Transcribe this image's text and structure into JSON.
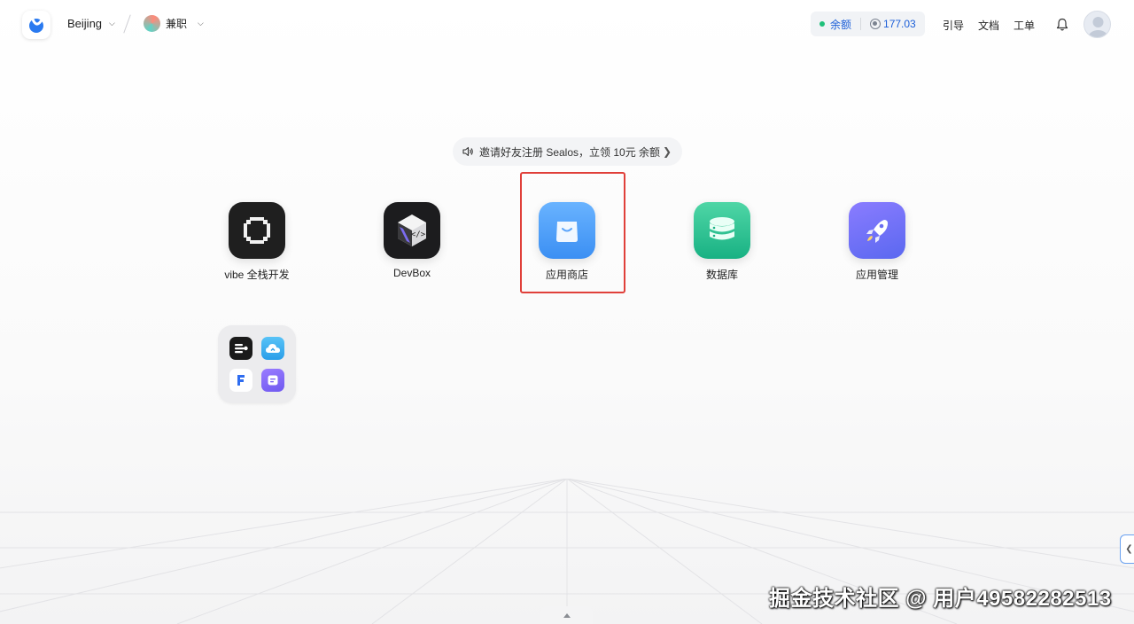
{
  "header": {
    "region": "Beijing",
    "workspace": "兼职",
    "balance_label": "余额",
    "balance_amount": "177.03",
    "nav": [
      "引导",
      "文档",
      "工单"
    ]
  },
  "promo": {
    "text": "邀请好友注册 Sealos，立领 10元 余额"
  },
  "apps": [
    {
      "label": "vibe 全栈开发",
      "icon": "vibe-icon"
    },
    {
      "label": "DevBox",
      "icon": "devbox-icon"
    },
    {
      "label": "应用商店",
      "icon": "app-store-icon",
      "highlighted": true
    },
    {
      "label": "数据库",
      "icon": "database-icon"
    },
    {
      "label": "应用管理",
      "icon": "rocket-icon"
    }
  ],
  "folder": {
    "apps": [
      "terminal-app-icon",
      "cloud-app-icon",
      "f-app-icon",
      "notes-app-icon"
    ]
  },
  "colors": {
    "accent": "#1c5fd8",
    "highlight_border": "#e0403a",
    "balance_dot": "#1fc07a"
  },
  "watermark": "掘金技术社区 @ 用户49582282513"
}
